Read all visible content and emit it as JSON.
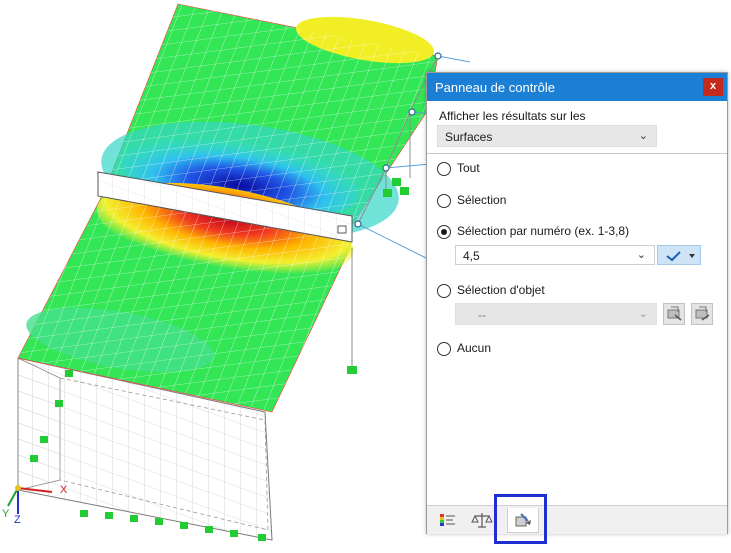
{
  "panel": {
    "title": "Panneau de contrôle",
    "close_label": "x",
    "section_label": "Afficher les résultats sur les",
    "result_type": "Surfaces"
  },
  "options": {
    "all": "Tout",
    "selection": "Sélection",
    "by_number": "Sélection par numéro (ex. 1-3,8)",
    "by_number_value": "4,5",
    "object_selection": "Sélection d'objet",
    "object_value": "--",
    "none": "Aucun",
    "selected": "by_number"
  },
  "axes": {
    "x": "X",
    "y": "Y",
    "z": "Z"
  },
  "colors": {
    "title_bar": "#1c7fd6",
    "close": "#c42b1c",
    "highlight": "#1f2ed0",
    "surface_green": "#33e655"
  },
  "icons": [
    "checkmark-icon",
    "select-objects-icon",
    "deselect-objects-icon",
    "results-colors-icon",
    "balance-icon",
    "display-settings-icon"
  ]
}
